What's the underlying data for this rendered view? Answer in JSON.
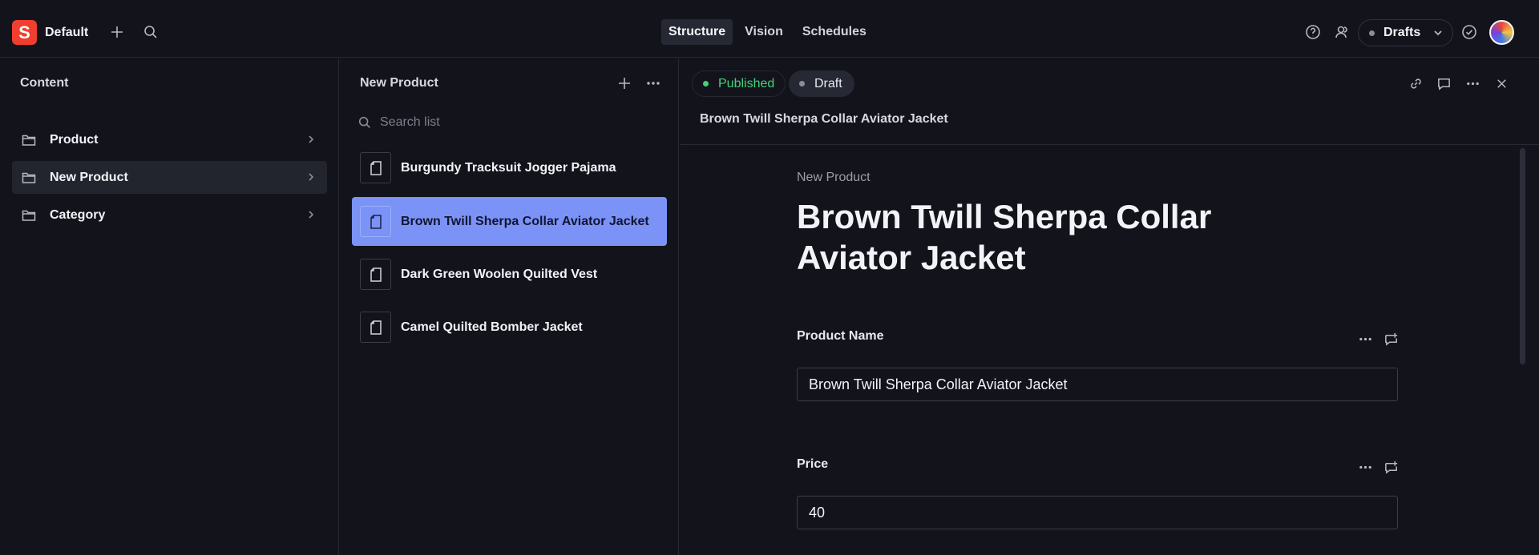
{
  "topbar": {
    "logo_letter": "S",
    "workspace": "Default",
    "tabs": [
      {
        "label": "Structure",
        "active": true
      },
      {
        "label": "Vision",
        "active": false
      },
      {
        "label": "Schedules",
        "active": false
      }
    ],
    "perspective": "Drafts"
  },
  "content_pane": {
    "title": "Content",
    "items": [
      {
        "label": "Product",
        "selected": false
      },
      {
        "label": "New Product",
        "selected": true
      },
      {
        "label": "Category",
        "selected": false
      }
    ]
  },
  "list_pane": {
    "title": "New Product",
    "search_placeholder": "Search list",
    "items": [
      {
        "label": "Burgundy Tracksuit Jogger Pajama",
        "selected": false
      },
      {
        "label": "Brown Twill Sherpa Collar Aviator Jacket",
        "selected": true
      },
      {
        "label": "Dark Green Woolen Quilted Vest",
        "selected": false
      },
      {
        "label": "Camel Quilted Bomber Jacket",
        "selected": false
      }
    ]
  },
  "document": {
    "status_published": "Published",
    "status_draft": "Draft",
    "header_title": "Brown Twill Sherpa Collar Aviator Jacket",
    "type_label": "New Product",
    "title": "Brown Twill Sherpa Collar Aviator Jacket",
    "fields": [
      {
        "label": "Product Name",
        "value": "Brown Twill Sherpa Collar Aviator Jacket"
      },
      {
        "label": "Price",
        "value": "40"
      }
    ]
  },
  "colors": {
    "background": "#13141b",
    "accent_selected": "#7b93f7",
    "published_green": "#43d17b",
    "brand_red": "#f03e2f"
  }
}
